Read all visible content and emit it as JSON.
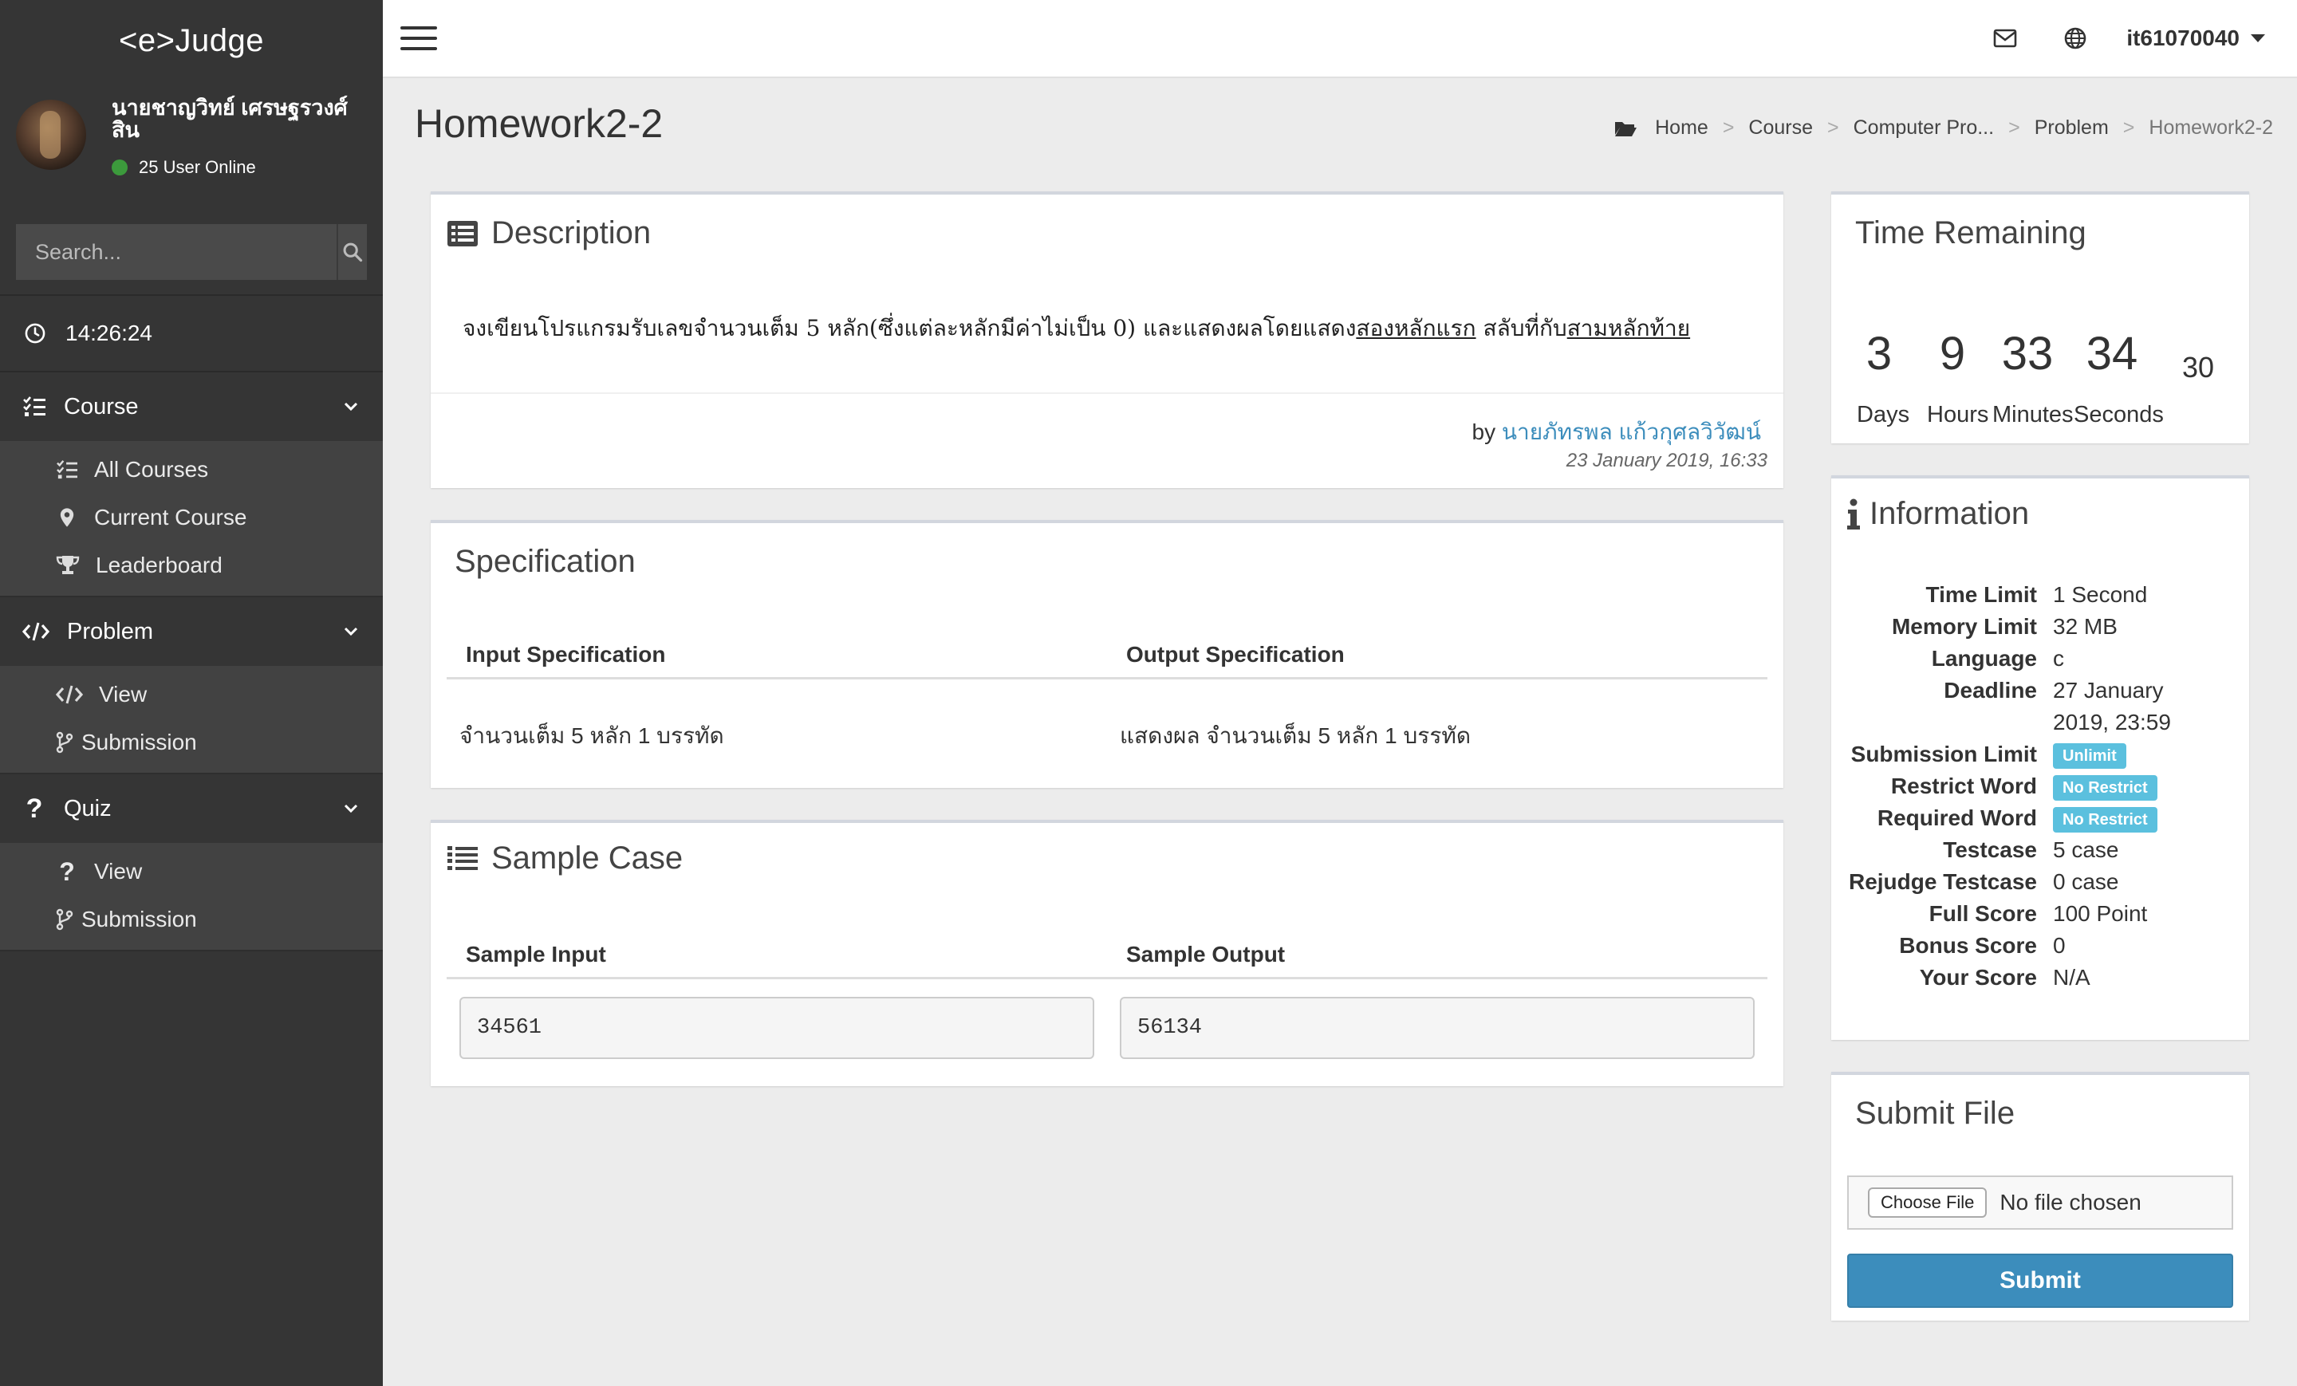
{
  "sidebar": {
    "brand": "<e>Judge",
    "user_name": "นายชาญวิทย์ เศรษฐรวงศ์สิน",
    "online": "25 User Online",
    "search_placeholder": "Search...",
    "clock": "14:26:24",
    "course": {
      "label": "Course",
      "items": [
        "All Courses",
        "Current Course",
        "Leaderboard"
      ]
    },
    "problem": {
      "label": "Problem",
      "items": [
        "View",
        "Submission"
      ]
    },
    "quiz": {
      "label": "Quiz",
      "items": [
        "View",
        "Submission"
      ]
    }
  },
  "topbar": {
    "username": "it61070040"
  },
  "page": {
    "title": "Homework2-2",
    "breadcrumb": [
      "Home",
      "Course",
      "Computer Pro...",
      "Problem",
      "Homework2-2"
    ]
  },
  "description": {
    "title": "Description",
    "text_1": "จงเขียนโปรแกรมรับเลขจำนวนเต็ม 5 หลัก(ซึ่งแต่ละหลักมีค่าไม่เป็น 0) และแสดงผลโดยแสดง",
    "underline_1": "สองหลักแรก",
    "text_2": " สลับที่กับ",
    "underline_2": "สามหลักท้าย",
    "by_label": "by",
    "author": "นายภัทรพล แก้วกุศลวิวัฒน์",
    "date": "23 January 2019, 16:33"
  },
  "specification": {
    "title": "Specification",
    "input_header": "Input Specification",
    "output_header": "Output Specification",
    "input_text": "จำนวนเต็ม 5 หลัก 1 บรรทัด",
    "output_text": "แสดงผล จำนวนเต็ม 5 หลัก 1 บรรทัด"
  },
  "sample": {
    "title": "Sample Case",
    "input_header": "Sample Input",
    "output_header": "Sample Output",
    "input": "34561",
    "output": "56134"
  },
  "time_remaining": {
    "title": "Time Remaining",
    "days": "3",
    "hours": "9",
    "minutes": "33",
    "seconds": "34",
    "extra": "30",
    "days_label": "Days",
    "hours_label": "Hours",
    "minutes_label": "Minutes",
    "seconds_label": "Seconds"
  },
  "information": {
    "title": "Information",
    "rows": [
      {
        "key": "Time Limit",
        "value": "1 Second"
      },
      {
        "key": "Memory Limit",
        "value": "32 MB"
      },
      {
        "key": "Language",
        "value": "c"
      },
      {
        "key": "Deadline",
        "value": "27 January 2019, 23:59"
      },
      {
        "key": "Submission Limit",
        "badge": "Unlimit"
      },
      {
        "key": "Restrict Word",
        "badge": "No Restrict"
      },
      {
        "key": "Required Word",
        "badge": "No Restrict"
      },
      {
        "key": "Testcase",
        "value": "5 case"
      },
      {
        "key": "Rejudge Testcase",
        "value": "0 case"
      },
      {
        "key": "Full Score",
        "value": "100 Point"
      },
      {
        "key": "Bonus Score",
        "value": "0"
      },
      {
        "key": "Your Score",
        "value": "N/A"
      }
    ]
  },
  "submit": {
    "title": "Submit File",
    "choose_file": "Choose File",
    "no_file": "No file chosen",
    "button": "Submit"
  },
  "colors": {
    "sidebar_bg": "#353535",
    "accent": "#3c8dbc",
    "badge": "#5bc0de",
    "online": "#3c9a3c"
  }
}
